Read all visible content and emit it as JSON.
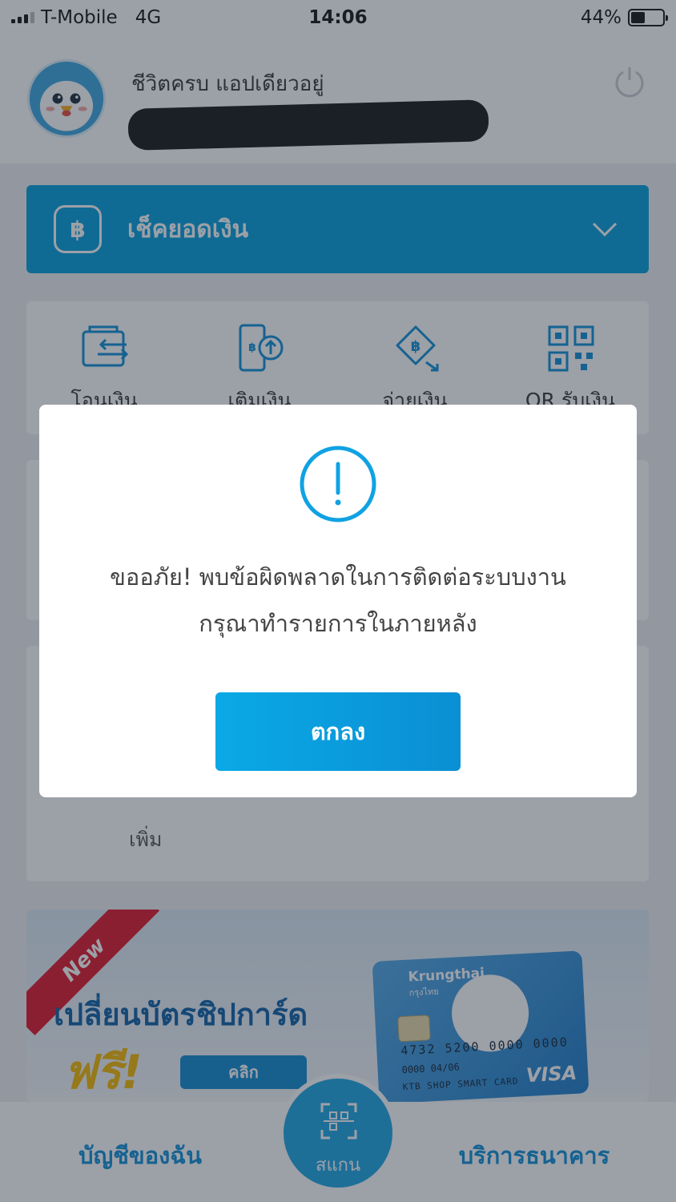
{
  "status_bar": {
    "carrier": "T-Mobile",
    "network": "4G",
    "time": "14:06",
    "battery": "44%",
    "battery_level": 0.44
  },
  "header": {
    "greeting": "ชีวิตครบ แอปเดียวอยู่",
    "avatar_icon": "mascot-avatar-icon",
    "power_icon": "power-icon"
  },
  "balance": {
    "label": "เช็คยอดเงิน",
    "icon_text": "฿"
  },
  "quick_actions": [
    {
      "label": "โอนเงิน",
      "icon": "wallet-transfer-icon"
    },
    {
      "label": "เติมเงิน",
      "icon": "topup-phone-icon"
    },
    {
      "label": "จ่ายเงิน",
      "icon": "pay-baht-icon"
    },
    {
      "label": "QR รับเงิน",
      "icon": "qr-code-icon"
    }
  ],
  "card3": {
    "add_label": "เพิ่ม"
  },
  "promo": {
    "ribbon": "New",
    "title": "เปลี่ยนบัตรชิปการ์ด",
    "free": "ฟรี!",
    "button": "คลิก",
    "card": {
      "bank": "Krungthai",
      "bank_sub": "กรุงไทย",
      "number": "4732 5200 0000 0000",
      "valid": "0000   04/06",
      "type": "KTB SHOP SMART CARD",
      "brand": "VISA"
    }
  },
  "bottom_nav": {
    "left": "บัญชีของฉัน",
    "scan": "สแกน",
    "right": "บริการธนาคาร"
  },
  "modal": {
    "icon": "exclamation-circle-icon",
    "message_line1": "ขออภัย! พบข้อผิดพลาดในการติดต่อระบบงาน",
    "message_line2": "กรุณาทำรายการในภายหลัง",
    "ok_button": "ตกลง"
  },
  "colors": {
    "primary": "#019edc",
    "accent_yellow": "#f5b800",
    "ribbon_red": "#e0142b",
    "nav_text": "#0a8ed8"
  }
}
